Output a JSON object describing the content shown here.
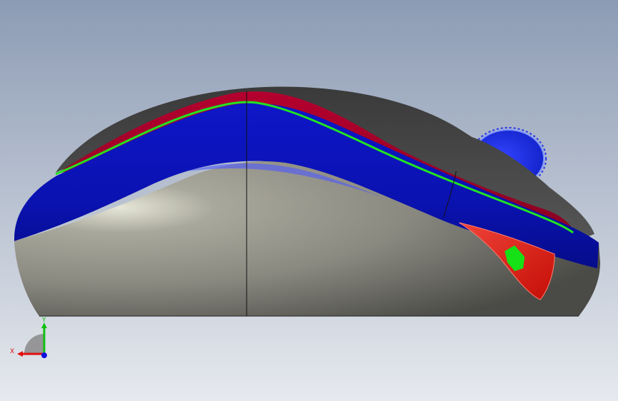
{
  "viewport": {
    "background_top": "#8c9bb4",
    "background_bottom": "#e6e9ee"
  },
  "model": {
    "name": "wireless-mouse",
    "colors": {
      "shell_dark": "#454545",
      "shell_silver": "#a9a89c",
      "band_blue": "#0a12b8",
      "band_red": "#a8002a",
      "edge_green": "#22e322",
      "wheel_blue": "#1f31e0",
      "battery_door_red": "#e21a0e",
      "indicator_green": "#16e016"
    }
  },
  "triad": {
    "x_label": "X",
    "y_label": "Y",
    "x_color": "#e01010",
    "y_color": "#10c010",
    "z_color": "#1010e0"
  }
}
